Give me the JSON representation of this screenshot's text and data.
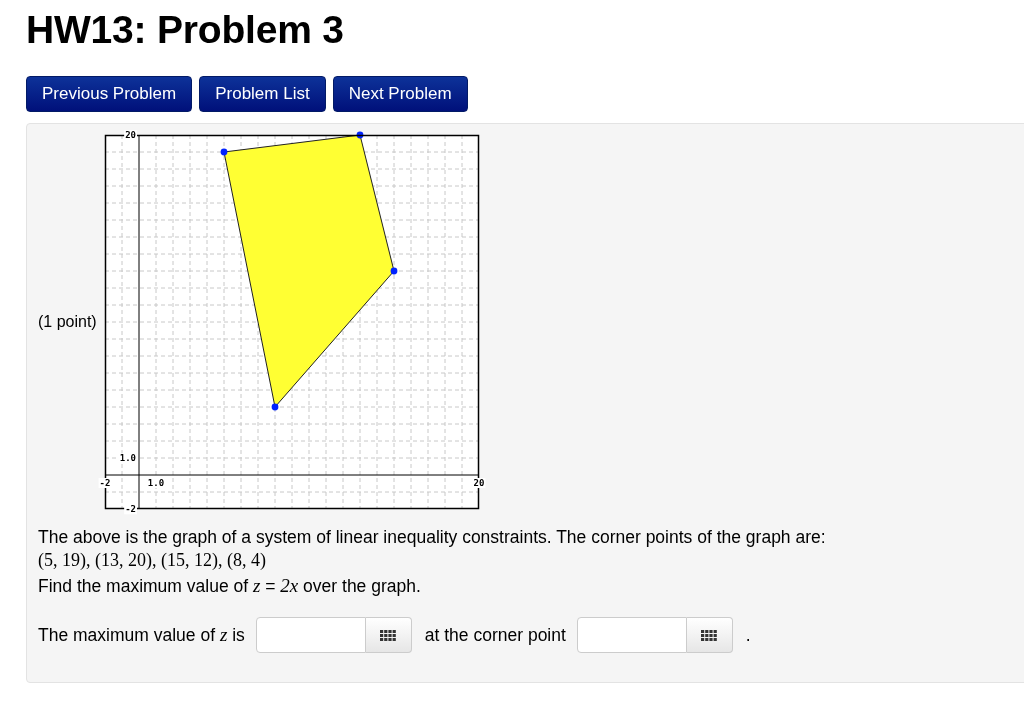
{
  "page": {
    "title": "HW13: Problem 3"
  },
  "nav_buttons": [
    {
      "label": "Previous Problem"
    },
    {
      "label": "Problem List"
    },
    {
      "label": "Next Problem"
    }
  ],
  "problem": {
    "points": "(1 point)",
    "chart_data": [
      {
        "type": "scatter",
        "xlim": [
          -2,
          20
        ],
        "ylim": [
          -2,
          20
        ],
        "grid": true,
        "xticks": [
          {
            "value": -2,
            "label": "-2"
          },
          {
            "value": 1,
            "label": "1.0"
          },
          {
            "value": 20,
            "label": "20"
          }
        ],
        "yticks": [
          {
            "value": 20,
            "label": "20"
          },
          {
            "value": 1,
            "label": "1.0"
          },
          {
            "value": -2,
            "label": "-2"
          }
        ],
        "x": [
          5,
          13,
          15,
          8
        ],
        "values": [
          19,
          20,
          12,
          4
        ],
        "color": "#0022ff",
        "marker": "circle"
      }
    ],
    "intro": "The above is the graph of a system of linear inequality constraints. The corner points of the graph are:",
    "corner_points": "(5, 19), (13, 20), (15, 12), (8, 4)",
    "question": "Find the maximum value of *z* = *2x* over the graph.",
    "answer_row": [
      {
        "kind": "text",
        "text": "The maximum value of *z* is"
      },
      {
        "kind": "answer"
      },
      {
        "kind": "text",
        "text": "at the corner point"
      },
      {
        "kind": "answer"
      },
      {
        "kind": "text",
        "text": "."
      }
    ]
  }
}
